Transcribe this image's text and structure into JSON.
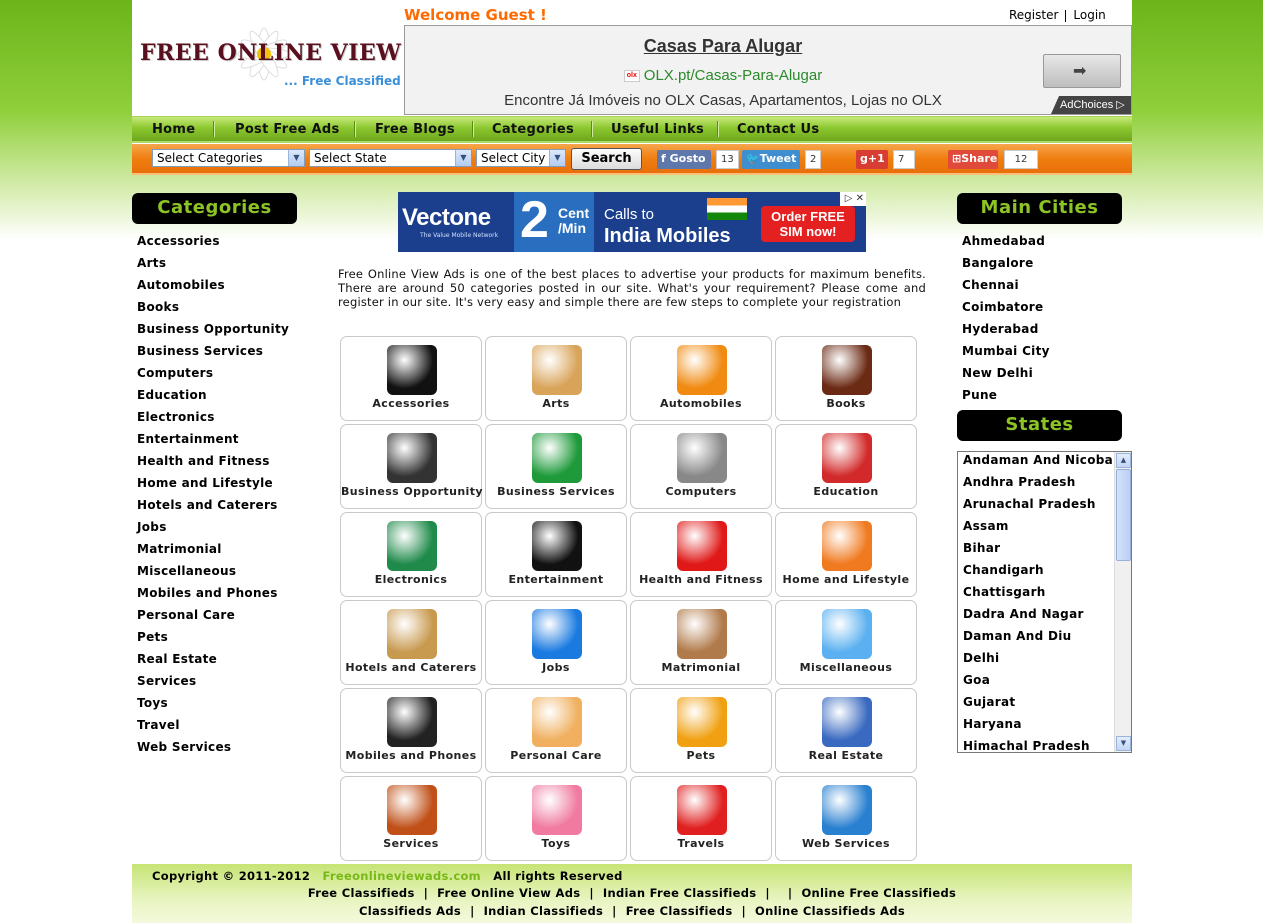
{
  "header": {
    "logo_text": "FREE ONLINE VIEW ADS",
    "logo_tagline": "... Free Classified",
    "welcome": "Welcome Guest !",
    "register": "Register",
    "login": "Login"
  },
  "ad_top": {
    "title": "Casas Para Alugar",
    "url": "OLX.pt/Casas-Para-Alugar",
    "description": "Encontre Já Imóveis no OLX Casas, Apartamentos, Lojas no OLX",
    "adchoices": "AdChoices"
  },
  "nav": [
    "Home",
    "Post Free Ads",
    "Free Blogs",
    "Categories",
    "Useful Links",
    "Contact Us"
  ],
  "search": {
    "categories_select": "Select Categories",
    "state_select": "Select State",
    "city_select": "Select City",
    "button": "Search"
  },
  "social": {
    "like_label": "Gosto",
    "like_count": "13",
    "tweet_label": "Tweet",
    "tweet_count": "2",
    "gplus_label": "+1",
    "gplus_count": "7",
    "share_label": "Share",
    "share_count": "12"
  },
  "sidebar_left": {
    "heading": "Categories",
    "items": [
      "Accessories",
      "Arts",
      "Automobiles",
      "Books",
      "Business Opportunity",
      "Business Services",
      "Computers",
      "Education",
      "Electronics",
      "Entertainment",
      "Health and Fitness",
      "Home and Lifestyle",
      "Hotels and Caterers",
      "Jobs",
      "Matrimonial",
      "Miscellaneous",
      "Mobiles and Phones",
      "Personal Care",
      "Pets",
      "Real Estate",
      "Services",
      "Toys",
      "Travel",
      "Web Services"
    ]
  },
  "sidebar_right": {
    "cities_heading": "Main Cities",
    "cities": [
      "Ahmedabad",
      "Bangalore",
      "Chennai",
      "Coimbatore",
      "Hyderabad",
      "Mumbai City",
      "New Delhi",
      "Pune"
    ],
    "states_heading": "States",
    "states": [
      "Andaman And Nicobar",
      "Andhra Pradesh",
      "Arunachal Pradesh",
      "Assam",
      "Bihar",
      "Chandigarh",
      "Chattisgarh",
      "Dadra And Nagar",
      "Daman And Diu",
      "Delhi",
      "Goa",
      "Gujarat",
      "Haryana",
      "Himachal Pradesh"
    ]
  },
  "banner_ad": {
    "brand": "Vectone",
    "brand_sub": "The Value Mobile Network",
    "price": "2",
    "price_unit": "Cent /Min",
    "line1": "Calls to",
    "line2": "India Mobiles",
    "cta": "Order FREE SIM now!"
  },
  "intro": "Free Online View Ads is one of the best places to advertise your products for maximum benefits. There are around 50 categories posted in our site. What's your requirement? Please come and register in our site. It's very easy and simple there are few steps to complete your registration",
  "grid": [
    {
      "label": "Accessories",
      "icon": "gears-icon",
      "color": "#111111"
    },
    {
      "label": "Arts",
      "icon": "palette-icon",
      "color": "#d9a45a"
    },
    {
      "label": "Automobiles",
      "icon": "car-icon",
      "color": "#f08a10"
    },
    {
      "label": "Books",
      "icon": "books-icon",
      "color": "#6b2a14"
    },
    {
      "label": "Business Opportunity",
      "icon": "handshake-icon",
      "color": "#333333"
    },
    {
      "label": "Business Services",
      "icon": "globe-gear-icon",
      "color": "#1e9a3a"
    },
    {
      "label": "Computers",
      "icon": "monitor-icon",
      "color": "#888888"
    },
    {
      "label": "Education",
      "icon": "graduate-icon",
      "color": "#d22a2a"
    },
    {
      "label": "Electronics",
      "icon": "circuit-board-icon",
      "color": "#1f8a4a"
    },
    {
      "label": "Entertainment",
      "icon": "film-icon",
      "color": "#111111"
    },
    {
      "label": "Health and Fitness",
      "icon": "health-heart-icon",
      "color": "#e01818"
    },
    {
      "label": "Home and Lifestyle",
      "icon": "home-icon",
      "color": "#f07a20"
    },
    {
      "label": "Hotels and Caterers",
      "icon": "bed-icon",
      "color": "#c89a50"
    },
    {
      "label": "Jobs",
      "icon": "job-icon",
      "color": "#1a7ae0"
    },
    {
      "label": "Matrimonial",
      "icon": "hands-icon",
      "color": "#b07a4a"
    },
    {
      "label": "Miscellaneous",
      "icon": "bulb-icon",
      "color": "#5ab0f0"
    },
    {
      "label": "Mobiles and Phones",
      "icon": "phone-icon",
      "color": "#222222"
    },
    {
      "label": "Personal Care",
      "icon": "person-icon",
      "color": "#f0b060"
    },
    {
      "label": "Pets",
      "icon": "dog-icon",
      "color": "#f0a010"
    },
    {
      "label": "Real Estate",
      "icon": "buildings-icon",
      "color": "#3a6ac0"
    },
    {
      "label": "Services",
      "icon": "tools-icon",
      "color": "#c05018"
    },
    {
      "label": "Toys",
      "icon": "toy-clock-icon",
      "color": "#f07aa0"
    },
    {
      "label": "Travels",
      "icon": "suitcase-icon",
      "color": "#e02020"
    },
    {
      "label": "Web Services",
      "icon": "globe-icon",
      "color": "#2a80d0"
    }
  ],
  "footer": {
    "copyright": "Copyright © 2011-2012",
    "site": "Freeonlineviewads.com",
    "rights": "All rights Reserved",
    "links_row1": [
      "Free Classifieds",
      "Free Online View Ads",
      "Indian Free Classifieds",
      "Online Free Classifieds"
    ],
    "links_row2": [
      "Classifieds Ads",
      "Indian Classifieds",
      "Free Classifieds",
      "Online Classifieds Ads"
    ]
  },
  "colors": {
    "green": "#6cb41a",
    "orange": "#f07e10",
    "heading_green": "#8bc424",
    "welcome_orange": "#ff6a00"
  }
}
